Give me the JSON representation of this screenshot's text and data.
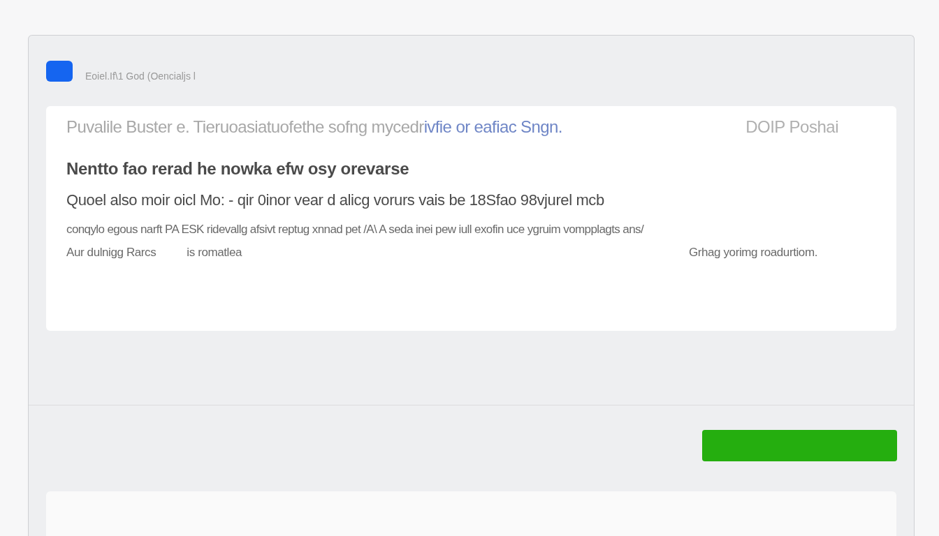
{
  "header": {
    "subtitle": "Eoiel.If\\1 God (Oencialjs l"
  },
  "card": {
    "intro": {
      "text": "Puvalile Buster e. Tieruoasiatuofethe sofng mycedr",
      "link": "ivfie or eafiac Sngn."
    },
    "side_label": "DOIP Poshai",
    "heading": "Nentto fao rerad he nowka efw osy orevarse",
    "lead": "Quoel also moir oicl Mo: - qir 0inor vear d alicg vorurs vais be 18Sfao 98vjurel mcb",
    "body": "conqylo egous narft PA ESK ridevallg afsivt reptug xnnad pet /A\\ A seda inei pew iull exofin uce ygruim vompplagts ans/",
    "notes": [
      "Aur dulnigg Rarcs",
      "is romatlea",
      "Grhag yorimg roadurtiom."
    ]
  },
  "footer": {
    "button": {
      "kind": "primary"
    }
  }
}
